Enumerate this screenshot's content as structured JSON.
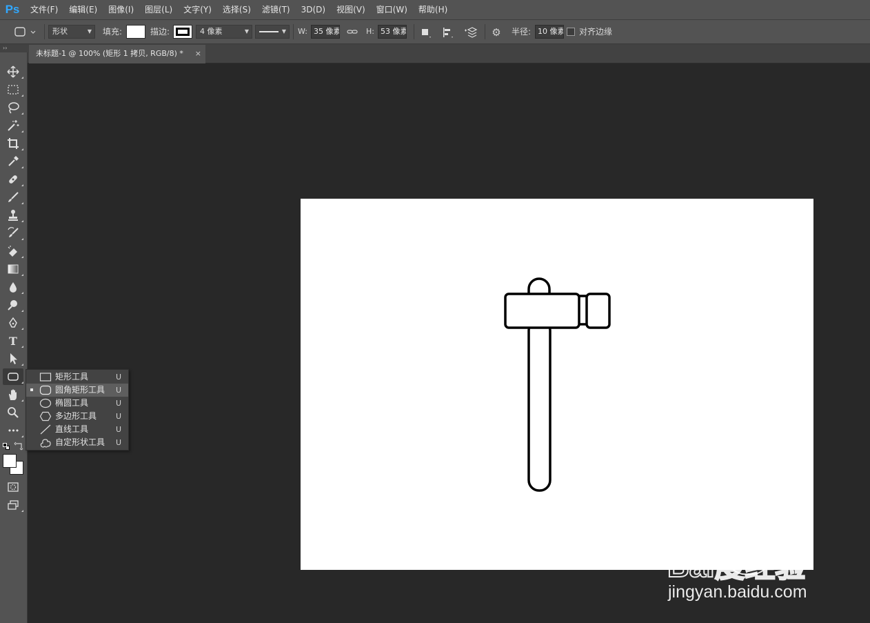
{
  "app": {
    "logo": "Ps"
  },
  "menu": [
    "文件(F)",
    "编辑(E)",
    "图像(I)",
    "图层(L)",
    "文字(Y)",
    "选择(S)",
    "滤镜(T)",
    "3D(D)",
    "视图(V)",
    "窗口(W)",
    "帮助(H)"
  ],
  "options": {
    "tool_mode": "形状",
    "fill_label": "填充:",
    "stroke_label": "描边:",
    "stroke_width": "4 像素",
    "w_label": "W:",
    "w_value": "35 像素",
    "h_label": "H:",
    "h_value": "53 像素",
    "radius_label": "半径:",
    "radius_value": "10 像素",
    "align_edges_label": "对齐边缘",
    "align_edges_checked": false,
    "fill_color": "#ffffff",
    "stroke_color": "#000000"
  },
  "document": {
    "tab_title": "未标题-1 @ 100% (矩形 1 拷贝, RGB/8) *",
    "close_glyph": "×"
  },
  "toolbar": {
    "collapse_glyph": "››",
    "tools": [
      "move-tool",
      "marquee-tool",
      "lasso-tool",
      "magic-wand-tool",
      "crop-tool",
      "eyedropper-tool",
      "healing-brush-tool",
      "brush-tool",
      "clone-stamp-tool",
      "history-brush-tool",
      "eraser-tool",
      "gradient-tool",
      "blur-tool",
      "dodge-tool",
      "pen-tool",
      "type-tool",
      "path-selection-tool",
      "rounded-rectangle-tool",
      "hand-tool",
      "zoom-tool",
      "more-tools"
    ],
    "active_tool": "rounded-rectangle-tool",
    "type_tool_glyph": "T",
    "more_glyph": "•••"
  },
  "flyout": {
    "items": [
      {
        "label": "矩形工具",
        "key": "U",
        "icon": "rectangle-icon",
        "selected": false
      },
      {
        "label": "圆角矩形工具",
        "key": "U",
        "icon": "rounded-rectangle-icon",
        "selected": true
      },
      {
        "label": "椭圆工具",
        "key": "U",
        "icon": "ellipse-icon",
        "selected": false
      },
      {
        "label": "多边形工具",
        "key": "U",
        "icon": "polygon-icon",
        "selected": false
      },
      {
        "label": "直线工具",
        "key": "U",
        "icon": "line-icon",
        "selected": false
      },
      {
        "label": "自定形状工具",
        "key": "U",
        "icon": "custom-shape-icon",
        "selected": false
      }
    ]
  },
  "colors": {
    "foreground": "#ffffff",
    "background": "#ffffff",
    "accent": "#31a8ff"
  },
  "canvas": {
    "background": "#ffffff",
    "drawing": "hammer-shape"
  },
  "watermark": {
    "logo": "Bai度经验",
    "url": "jingyan.baidu.com"
  }
}
